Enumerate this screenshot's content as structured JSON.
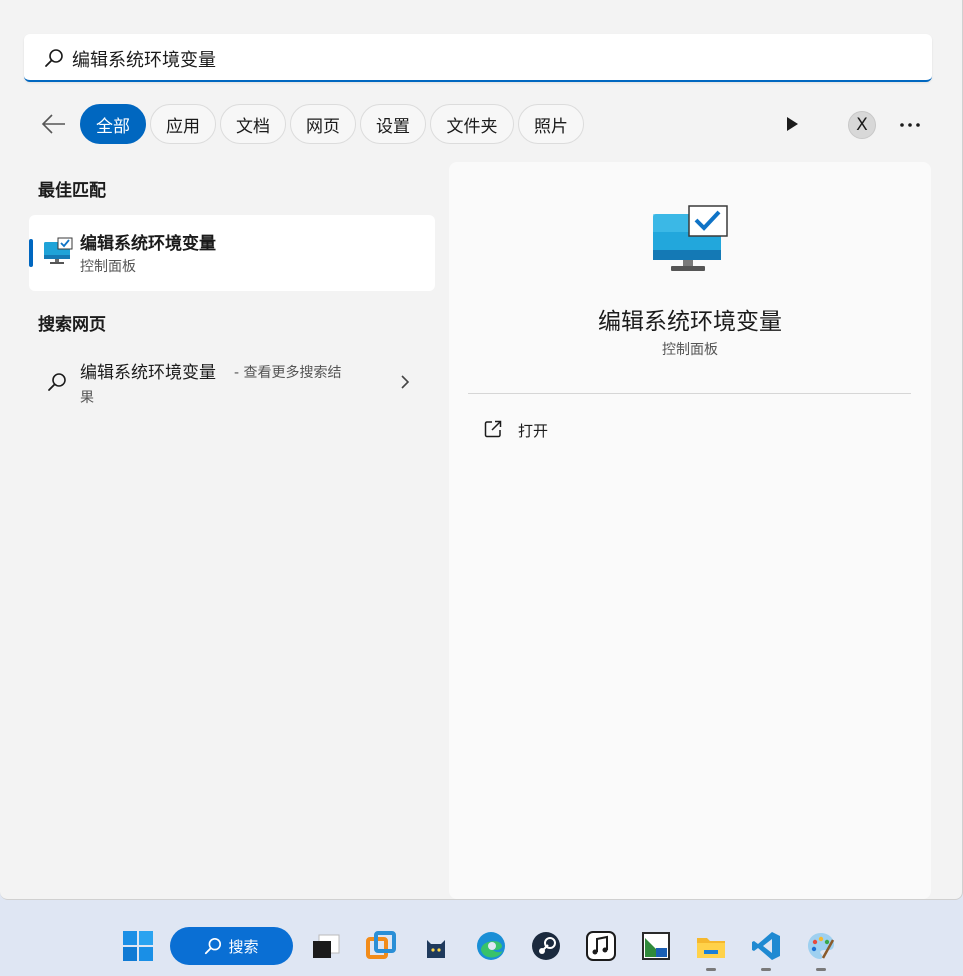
{
  "search": {
    "query": "编辑系统环境变量"
  },
  "filters": [
    "全部",
    "应用",
    "文档",
    "网页",
    "设置",
    "文件夹",
    "照片"
  ],
  "account": {
    "initial": "X"
  },
  "best_match": {
    "section_title": "最佳匹配",
    "title": "编辑系统环境变量",
    "subtitle": "控制面板"
  },
  "web_search": {
    "section_title": "搜索网页",
    "query": "编辑系统环境变量",
    "suffix": "- 查看更多搜索结",
    "suffix_wrap": "果"
  },
  "detail": {
    "title": "编辑系统环境变量",
    "subtitle": "控制面板",
    "actions": [
      "打开"
    ]
  },
  "taskbar": {
    "search_label": "搜索",
    "apps": [
      "start-icon",
      "task-view-icon",
      "vmware-icon",
      "cat-app-icon",
      "edge-icon",
      "steam-icon",
      "music-icon",
      "image-viewer-icon",
      "file-explorer-icon",
      "vscode-icon",
      "paint-icon"
    ]
  },
  "colors": {
    "accent": "#0067c0",
    "taskbar_search": "#0a6fd4"
  }
}
